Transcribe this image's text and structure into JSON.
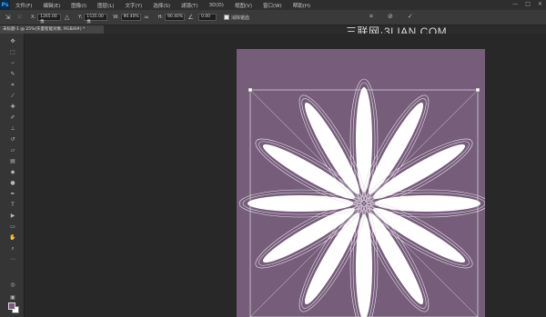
{
  "app": {
    "logo": "Ps"
  },
  "menu": {
    "items": [
      "文件(F)",
      "编辑(E)",
      "图像(I)",
      "图层(L)",
      "文字(Y)",
      "选择(S)",
      "滤镜(T)",
      "3D(D)",
      "视图(V)",
      "窗口(W)",
      "帮助(H)"
    ]
  },
  "window_controls": {
    "minimize": "—",
    "restore": "□",
    "close": "✕"
  },
  "options": {
    "x_label": "X:",
    "x_value": "1265.00 像",
    "y_label": "Y:",
    "y_value": "1535.00 像",
    "w_label": "W:",
    "w_value": "90.40%",
    "h_label": "H:",
    "h_value": "90.40%",
    "angle_value": "0.00",
    "antialias_label": "消除锯齿",
    "cancel_icon": "⊘",
    "commit_icon": "✓"
  },
  "document": {
    "tab_label": "未标题-1 @ 25%(矢量智能对象, RGB/8#) *"
  },
  "watermark": "三联网·3LIAN.COM",
  "colors": {
    "canvas_background": "#765e7b",
    "foreground_swatch": "#7a5878",
    "background_swatch": "#ffffff",
    "petal_fill": "#ffffff"
  },
  "flower": {
    "petal_count": 12
  }
}
